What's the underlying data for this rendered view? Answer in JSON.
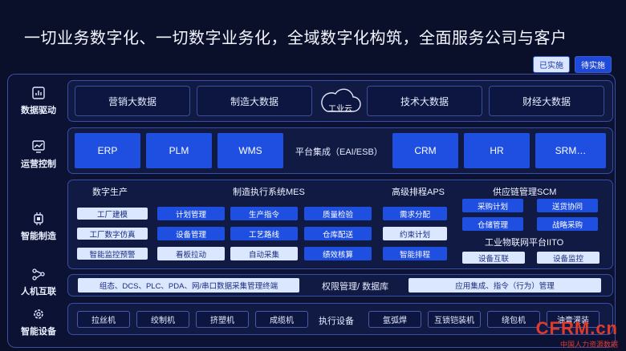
{
  "title": "一切业务数字化、一切数字业务化，全域数字化构筑，全面服务公司与客户",
  "legend": {
    "implemented": "已实施",
    "planned": "待实施"
  },
  "layers": {
    "data_driven": "数据驱动",
    "ops_control": "运营控制",
    "smart_mfg": "智能制造",
    "hmi": "人机互联",
    "smart_equipment": "智能设备"
  },
  "data_row": {
    "marketing": "营销大数据",
    "manufacturing": "制造大数据",
    "cloud": "工业云",
    "technology": "技术大数据",
    "finance": "财经大数据"
  },
  "ops_row": {
    "erp": "ERP",
    "plm": "PLM",
    "wms": "WMS",
    "platform": "平台集成（EAI/ESB）",
    "crm": "CRM",
    "hr": "HR",
    "srm": "SRM…"
  },
  "mfg": {
    "digital_production": {
      "title": "数字生产",
      "items": [
        "工厂建模",
        "工厂数字仿真",
        "智能监控预警"
      ]
    },
    "mes": {
      "title": "制造执行系统MES",
      "col1": [
        "计划管理",
        "设备管理",
        "看板拉动"
      ],
      "col2": [
        "生产指令",
        "工艺路线",
        "自动采集"
      ],
      "col3": [
        "质量检验",
        "仓库配送",
        "绩效核算"
      ]
    },
    "aps": {
      "title": "高级排程APS",
      "items": [
        "需求分配",
        "约束计划",
        "智能排程"
      ]
    },
    "scm": {
      "title": "供应链管理SCM",
      "col1": [
        "采购计划",
        "仓储管理"
      ],
      "col2": [
        "送货协同",
        "战略采购"
      ]
    },
    "iot": {
      "title": "工业物联网平台IITO",
      "items": [
        "设备互联",
        "设备监控"
      ]
    }
  },
  "hmi_row": {
    "left": "组态、DCS、PLC、PDA、网/串口数据采集管理终端",
    "center": "权限管理/ 数据库",
    "right": "应用集成、指令（行为）管理"
  },
  "equipment_row": {
    "items_left": [
      "拉丝机",
      "绞制机",
      "挤塑机",
      "成缆机"
    ],
    "center": "执行设备",
    "items_right": [
      "氩弧焊",
      "互锁铠装机",
      "绕包机",
      "油膏灌装"
    ]
  },
  "watermark": {
    "brand": "CFRM.cn",
    "tagline": "中国人力资源数据"
  },
  "colors": {
    "accent": "#1e4fe0",
    "implemented": "#dbe6ff",
    "background": "#0a0f2a"
  }
}
